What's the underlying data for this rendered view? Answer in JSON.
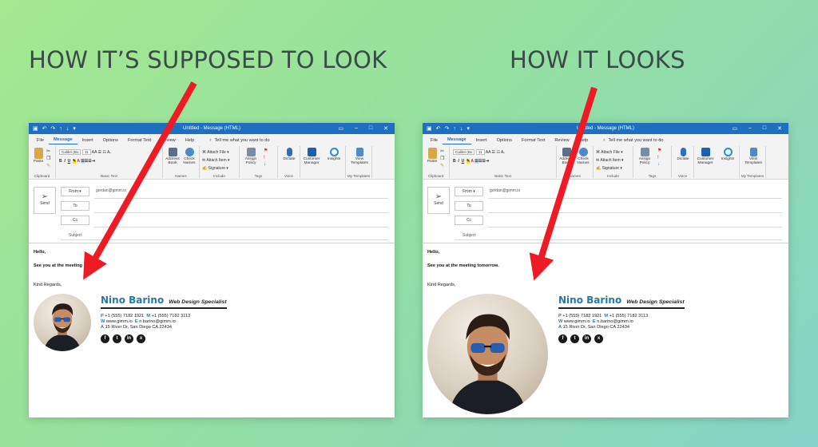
{
  "headings": {
    "left": "HOW IT’S SUPPOSED TO LOOK",
    "right": "HOW IT LOOKS"
  },
  "window": {
    "title": "Untitled - Message (HTML)",
    "menu": [
      "File",
      "Message",
      "Insert",
      "Options",
      "Format Text",
      "Review",
      "Help"
    ],
    "tell_me": "Tell me what you want to do",
    "ribbon": {
      "paste": "Paste",
      "clipboard": "Clipboard",
      "font": "Calibri (Bo",
      "size": "11",
      "basic_text": "Basic Text",
      "address_book": "Address Book",
      "check_names": "Check Names",
      "names": "Names",
      "attach_file": "Attach File",
      "attach_item": "Attach Item",
      "signature": "Signature",
      "include": "Include",
      "assign_policy": "Assign Policy",
      "tags": "Tags",
      "dictate": "Dictate",
      "voice": "Voice",
      "customer_manager": "Customer Manager",
      "insights": "Insights",
      "view_templates": "View Templates",
      "my_templates": "My Templates"
    },
    "send": "Send",
    "from": "From",
    "to": "To",
    "cc": "Cc",
    "subject": "Subject",
    "from_value": "gordan@gimm.io"
  },
  "message": {
    "greeting": "Hello,",
    "left_line": "See you at the meeting",
    "right_line": "See you at the meeting tomorrow.",
    "closing": "Kind Regards,"
  },
  "signature": {
    "name": "Nino Barino",
    "role": "Web Design Specialist",
    "p_label": "P",
    "p_value": "+1 (555) 7182 1921",
    "m_label": "M",
    "m_value": "+1 (555) 7182 3113",
    "w_label": "W",
    "w_value": "www.gimm.io",
    "e_label": "E",
    "e_value": "n.barino@gimm.io",
    "a_label": "A",
    "a_value": "15 River Dr, San Diego CA 22434",
    "social": [
      "f",
      "t",
      "in",
      "x"
    ]
  },
  "colors": {
    "arrow": "#ee1b24",
    "accent": "#2479a8",
    "titlebar": "#1e6fc0"
  }
}
